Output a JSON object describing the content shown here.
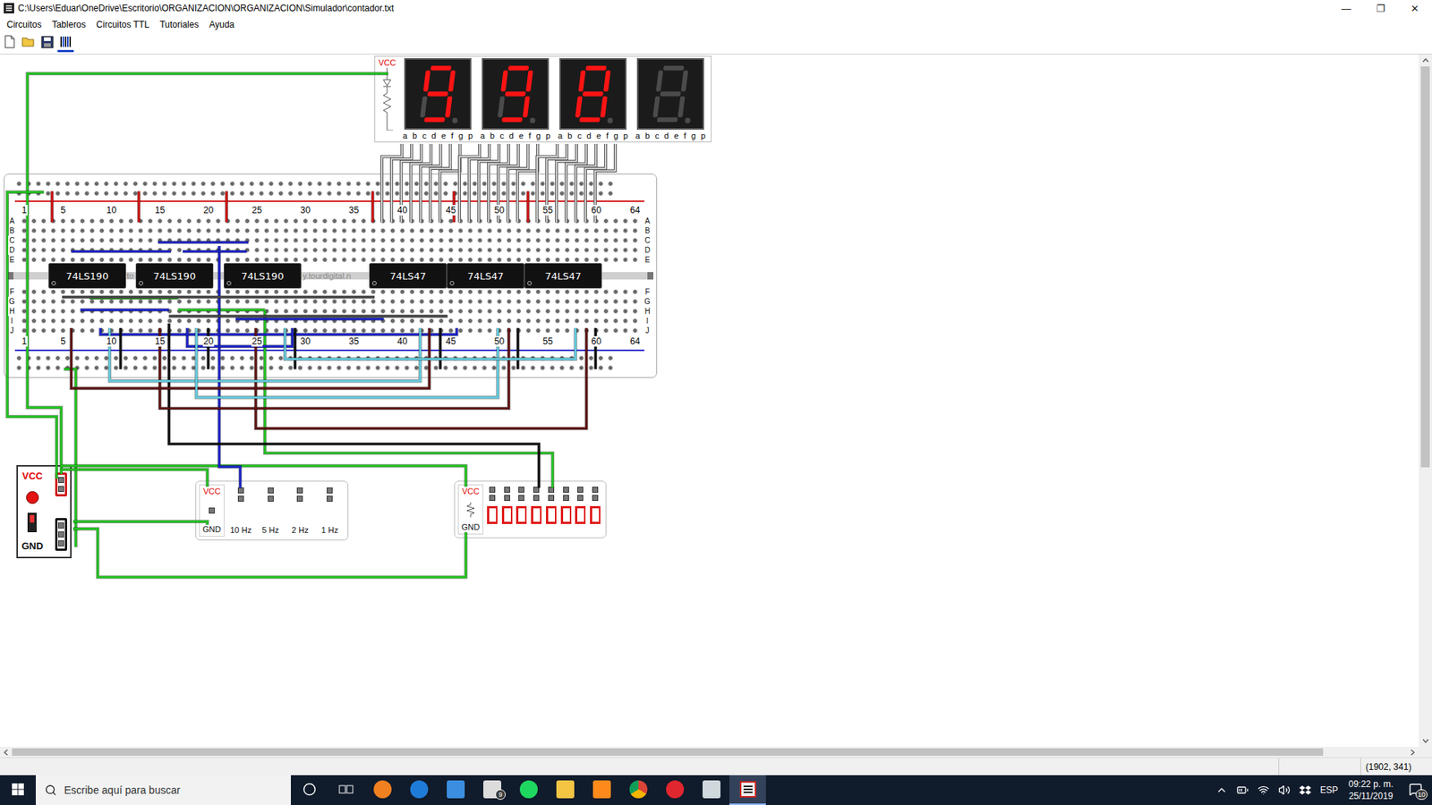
{
  "window": {
    "title": "C:\\Users\\Eduar\\OneDrive\\Escritorio\\ORGANIZACION\\ORGANIZACION\\Simulador\\contador.txt",
    "controls": [
      "—",
      "❐",
      "✕"
    ]
  },
  "menu": [
    {
      "label": "Circuitos"
    },
    {
      "label": "Tableros"
    },
    {
      "label": "Circuitos TTL"
    },
    {
      "label": "Tutoriales"
    },
    {
      "label": "Ayuda"
    }
  ],
  "toolbar": [
    {
      "kind": "new",
      "selected": false
    },
    {
      "kind": "open",
      "selected": false
    },
    {
      "kind": "save",
      "selected": false
    },
    {
      "kind": "chips",
      "selected": true
    }
  ],
  "display": {
    "label": "VCC",
    "pins": [
      "a",
      "b",
      "c",
      "d",
      "e",
      "f",
      "g",
      "p"
    ],
    "digits": [
      {
        "segments": {
          "a": true,
          "b": true,
          "c": true,
          "d": true,
          "e": false,
          "f": true,
          "g": true,
          "p": false
        }
      },
      {
        "segments": {
          "a": true,
          "b": true,
          "c": true,
          "d": true,
          "e": false,
          "f": true,
          "g": true,
          "p": false
        }
      },
      {
        "segments": {
          "a": true,
          "b": true,
          "c": true,
          "d": true,
          "e": true,
          "f": true,
          "g": true,
          "p": false
        }
      },
      {
        "segments": {
          "a": false,
          "b": false,
          "c": false,
          "d": false,
          "e": false,
          "f": false,
          "g": false,
          "p": false
        }
      }
    ]
  },
  "breadboard": {
    "columns": [
      "1",
      "5",
      "10",
      "15",
      "20",
      "25",
      "30",
      "35",
      "40",
      "45",
      "50",
      "55",
      "60",
      "64"
    ],
    "rows_top": [
      "A",
      "B",
      "C",
      "D",
      "E"
    ],
    "rows_bottom": [
      "F",
      "G",
      "H",
      "I",
      "J"
    ],
    "watermark": [
      "to",
      "y.tourdigital.n"
    ],
    "chips": [
      {
        "label": "74LS190"
      },
      {
        "label": "74LS190"
      },
      {
        "label": "74LS190"
      },
      {
        "label": "74LS47"
      },
      {
        "label": "74LS47"
      },
      {
        "label": "74LS47"
      }
    ]
  },
  "power": {
    "vcc": "VCC",
    "gnd": "GND",
    "on": true
  },
  "clock": {
    "vcc": "VCC",
    "gnd": "GND",
    "outputs": [
      "10 Hz",
      "5 Hz",
      "2 Hz",
      "1 Hz"
    ]
  },
  "leds": {
    "vcc": "VCC",
    "gnd": "GND",
    "lights": [
      {
        "on": false
      },
      {
        "on": false
      },
      {
        "on": false
      },
      {
        "on": false
      },
      {
        "on": false
      },
      {
        "on": false
      },
      {
        "on": false
      },
      {
        "on": false
      }
    ]
  },
  "scrollbars": {
    "vertical": {
      "level": 0.6
    },
    "horizontal": {
      "level": 0.94
    }
  },
  "status_bar": {
    "coords": "(1902, 341)"
  },
  "taskbar": {
    "search": "Escribe aquí para buscar",
    "mail_badge": "9",
    "language": "ESP",
    "time": "09:22 p. m.",
    "date": "25/11/2019",
    "notifications": "10"
  }
}
